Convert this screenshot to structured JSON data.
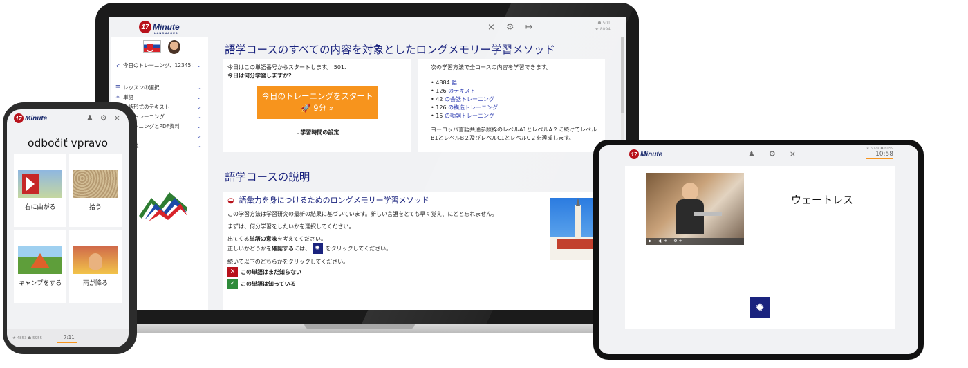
{
  "laptop": {
    "logo": {
      "badge": "17",
      "text": "Minute",
      "sub": "LANGUAGES"
    },
    "topbar_icons": [
      "tools-crossed-icon",
      "gear-icon",
      "logout-icon"
    ],
    "stats": {
      "line1": "☗ 501",
      "line2": "★ 8094"
    },
    "sidebar": {
      "items": [
        {
          "icon": "rocket-icon",
          "label": "今日のトレーニング、12345:",
          "chevron": "⌄"
        },
        {
          "icon": "list-icon",
          "label": "レッスンの選択",
          "chevron": "⌄"
        },
        {
          "icon": "bulb-icon",
          "label": "単語",
          "chevron": "⌄"
        },
        {
          "icon": "text-icon",
          "label": "会話形式のテキスト",
          "chevron": "⌄"
        },
        {
          "icon": "training-icon",
          "label": "動詞トレーニング",
          "chevron": "⌄"
        },
        {
          "icon": "pdf-icon",
          "label": "トレーニングとPDF資料",
          "chevron": "⌄"
        },
        {
          "icon": "more-icon",
          "label": "",
          "chevron": "⌄"
        },
        {
          "icon": "other-icon",
          "label": "その他",
          "chevron": "⌄"
        }
      ]
    },
    "main": {
      "title": "語学コースのすべての内容を対象としたロングメモリー学習メソッド",
      "left_card": {
        "line1": "今日はこの単語番号からスタートします。 501.",
        "line2": "今日は何分学習しますか?",
        "button_line1": "今日のトレーニングをスタート",
        "button_line2": "🚀 9分 »",
        "time_setting": "⌄学習時間の設定"
      },
      "right_card": {
        "intro": "次の学習方法で全コースの内容を学習できます。",
        "bullets": [
          {
            "num": "4884",
            "text": "語"
          },
          {
            "num": "126",
            "text": "のテキスト"
          },
          {
            "num": "42",
            "text": "の会話トレーニング"
          },
          {
            "num": "126",
            "text": "の構造トレーニング"
          },
          {
            "num": "15",
            "text": "の動詞トレーニング"
          }
        ],
        "footer": "ヨーロッパ言語共通参照枠のレベルA1とレベルA２に続けてレベルB1とレベルB２及びレベルC1とレベルC２を達成します。"
      },
      "section_title": "語学コースの説明",
      "desc_heading": "語彙力を身につけるためのロングメモリー学習メソッド",
      "desc_p1": "この学習方法は学習研究の最新の結果に基づいています。新しい言語をとても早く覚え、にどと忘れません。",
      "desc_p2": "まずは、何分学習をしたいかを選択してください。",
      "desc_p3a_pre": "出てくる",
      "desc_p3a_bold": "単語の意味",
      "desc_p3a_post": "を考えてください。",
      "desc_p3b_pre": "正しいかどうかを",
      "desc_p3b_bold": "確認する",
      "desc_p3b_post": "には、",
      "desc_p3b_end": "をクリックしてください。",
      "desc_p4": "続いて以下のどちらかをクリックしてください。",
      "unknown_label": "この単語はまだ知らない",
      "known_label": "この単語は知っている"
    }
  },
  "phone": {
    "logo": {
      "badge": "17",
      "text": "Minute"
    },
    "icons": [
      "training-icon",
      "gear-icon",
      "tools-crossed-icon"
    ],
    "word": "odbočiť vpravo",
    "tiles": [
      {
        "caption": "右に曲がる"
      },
      {
        "caption": "拾う"
      },
      {
        "caption": "キャンプをする"
      },
      {
        "caption": "雨が降る"
      }
    ],
    "bottom_stats": "★ 4853 ☗ 5955",
    "bottom_time": "7:11"
  },
  "tablet": {
    "logo": {
      "badge": "17",
      "text": "Minute"
    },
    "icons": [
      "training-icon",
      "gear-icon",
      "tools-crossed-icon"
    ],
    "stats": "★ 6079 ☗ 6059",
    "time": "10:58",
    "word": "ウェートレス",
    "video_controls": "▶   − ◀) +    − ⚙ +"
  },
  "colors": {
    "brand_navy": "#1a237e",
    "brand_red": "#b8121b",
    "accent_orange": "#f7941d",
    "link_blue": "#2a3ab0"
  }
}
